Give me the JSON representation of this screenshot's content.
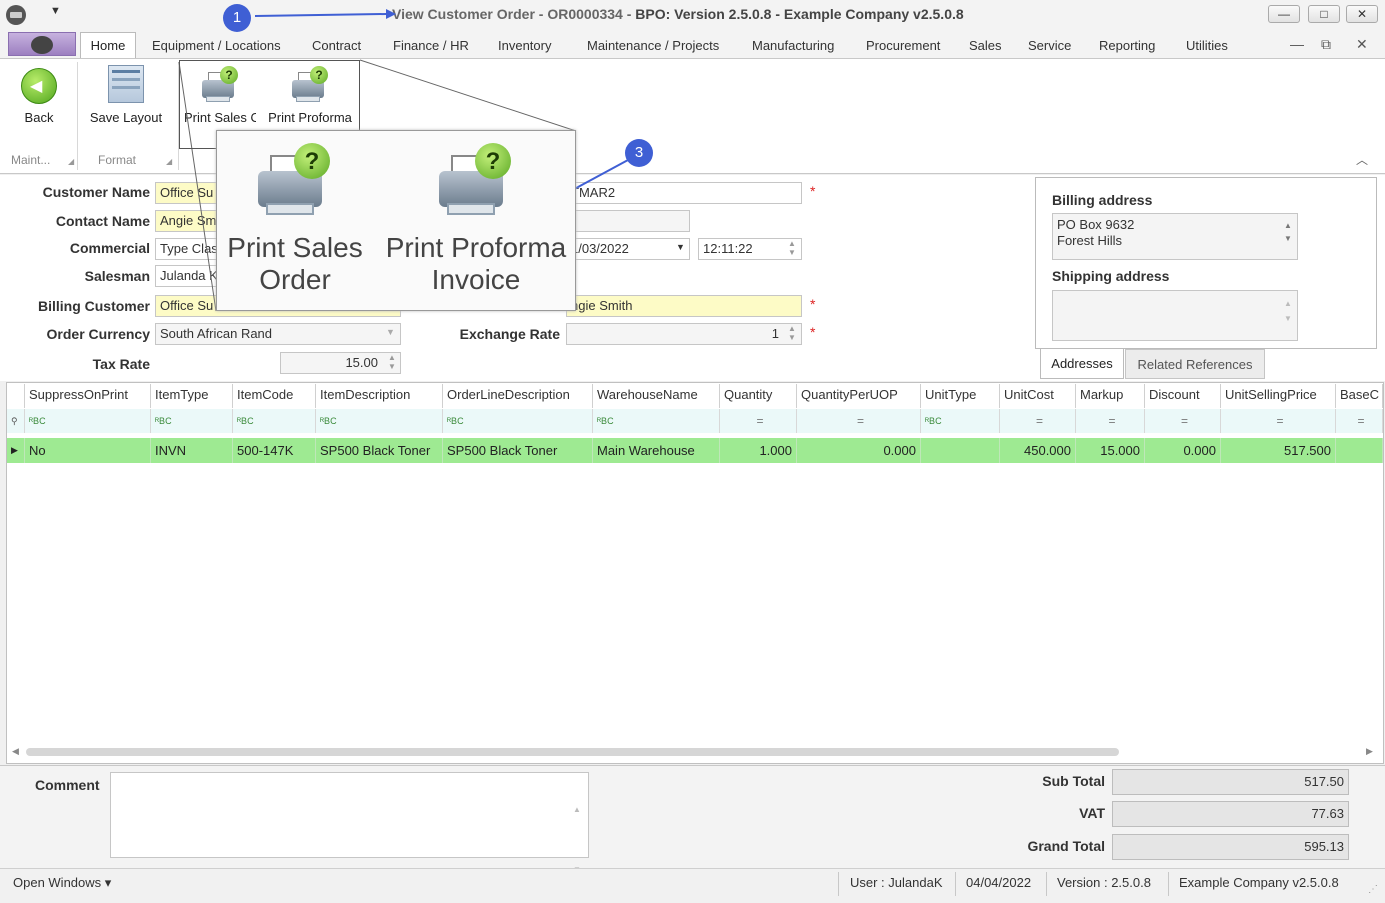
{
  "window": {
    "title_doc": "View Customer Order - OR0000334 - ",
    "title_app": "BPO: Version 2.5.0.8 - Example Company v2.5.0.8",
    "min_label": "—",
    "max_label": "□",
    "close_label": "✕"
  },
  "menu": {
    "home": "Home",
    "tabs": [
      "Equipment / Locations",
      "Contract",
      "Finance / HR",
      "Inventory",
      "Maintenance / Projects",
      "Manufacturing",
      "Procurement",
      "Sales",
      "Service",
      "Reporting",
      "Utilities"
    ]
  },
  "ribbon": {
    "back": "Back",
    "save_layout": "Save Layout",
    "print_sales_order": "Print Sales Or",
    "print_proforma": "Print Proforma",
    "group_maint": "Maint...",
    "group_format": "Format"
  },
  "zoom": {
    "print_sales_order_l1": "Print Sales",
    "print_sales_order_l2": "Order",
    "print_proforma_l1": "Print Proforma",
    "print_proforma_l2": "Invoice"
  },
  "markers": {
    "m1": "1",
    "m3": "3"
  },
  "form": {
    "customer_name_label": "Customer Name",
    "customer_name": "Office Su",
    "contact_name_label": "Contact Name",
    "contact_name": "Angie Sm",
    "commercial_label": "Commercial",
    "commercial": "Type Clas",
    "salesman_label": "Salesman",
    "salesman": "Julanda K",
    "billing_customer_label": "Billing Customer",
    "billing_customer": "Office Su",
    "order_currency_label": "Order Currency",
    "order_currency": "South African Rand",
    "tax_rate_label": "Tax Rate",
    "tax_rate": "15.00",
    "reference": "TMAR2",
    "order_date": "1/03/2022",
    "order_time": "12:11:22",
    "billing_contact": "ngie Smith",
    "exchange_rate_label": "Exchange Rate",
    "exchange_rate": "1",
    "required_mark": "*"
  },
  "address": {
    "billing_title": "Billing address",
    "billing_line1": "PO Box 9632",
    "billing_line2": "Forest Hills",
    "shipping_title": "Shipping address",
    "tab_addresses": "Addresses",
    "tab_related": "Related References"
  },
  "grid": {
    "columns": [
      "SuppressOnPrint",
      "ItemType",
      "ItemCode",
      "ItemDescription",
      "OrderLineDescription",
      "WarehouseName",
      "Quantity",
      "QuantityPerUOP",
      "UnitType",
      "UnitCost",
      "Markup",
      "Discount",
      "UnitSellingPrice",
      "BaseC"
    ],
    "filter_text": "ᴿBC",
    "filter_eq": "=",
    "row": [
      "No",
      "INVN",
      "500-147K",
      "SP500 Black Toner",
      "SP500 Black Toner",
      "Main Warehouse",
      "1.000",
      "0.000",
      "",
      "450.000",
      "15.000",
      "0.000",
      "517.500",
      ""
    ]
  },
  "totals": {
    "comment_label": "Comment",
    "sub_total_label": "Sub Total",
    "sub_total": "517.50",
    "vat_label": "VAT",
    "vat": "77.63",
    "grand_total_label": "Grand Total",
    "grand_total": "595.13"
  },
  "status": {
    "open_windows": "Open Windows ▾",
    "user": "User : JulandaK",
    "date": "04/04/2022",
    "version": "Version : 2.5.0.8",
    "company": "Example Company v2.5.0.8"
  }
}
